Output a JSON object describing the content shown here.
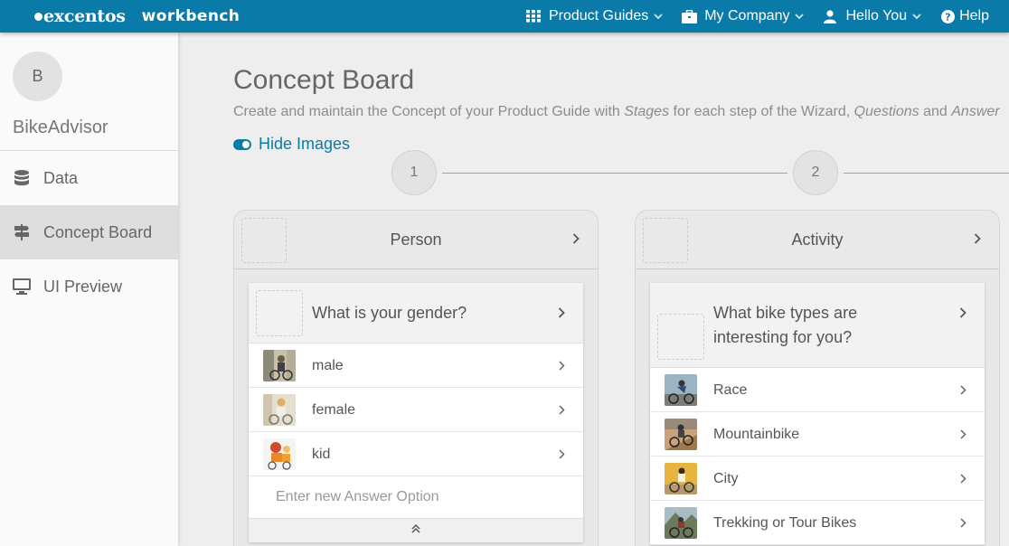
{
  "brand": {
    "logo": "excentos",
    "product": "workbench"
  },
  "topnav": {
    "product_guides": "Product Guides",
    "my_company": "My Company",
    "hello": "Hello You",
    "help": "Help"
  },
  "sidebar": {
    "avatar_initial": "B",
    "project_name": "BikeAdvisor",
    "items": [
      {
        "label": "Data",
        "icon": "database-icon"
      },
      {
        "label": "Concept Board",
        "icon": "signpost-icon",
        "active": true
      },
      {
        "label": "UI Preview",
        "icon": "monitor-icon"
      }
    ]
  },
  "main": {
    "title": "Concept Board",
    "description": {
      "part1": "Create and maintain the Concept of your Product Guide with ",
      "stages": "Stages",
      "part2": " for each step of the Wizard, ",
      "questions": "Questions",
      "part3": " and ",
      "answer": "Answer"
    },
    "toggle_label": "Hide Images",
    "steps": [
      "1",
      "2"
    ],
    "stages": [
      {
        "title": "Person",
        "question": "What is your gender?",
        "answers": [
          "male",
          "female",
          "kid"
        ],
        "new_answer_placeholder": "Enter new Answer Option"
      },
      {
        "title": "Activity",
        "question_line1": "What bike types are",
        "question_line2": "interesting for you?",
        "answers": [
          "Race",
          "Mountainbike",
          "City",
          "Trekking or Tour Bikes"
        ]
      }
    ]
  },
  "colors": {
    "topbar": "#0a7aa8",
    "accent": "#0a7aa8",
    "sidebar_active": "#dedede"
  }
}
